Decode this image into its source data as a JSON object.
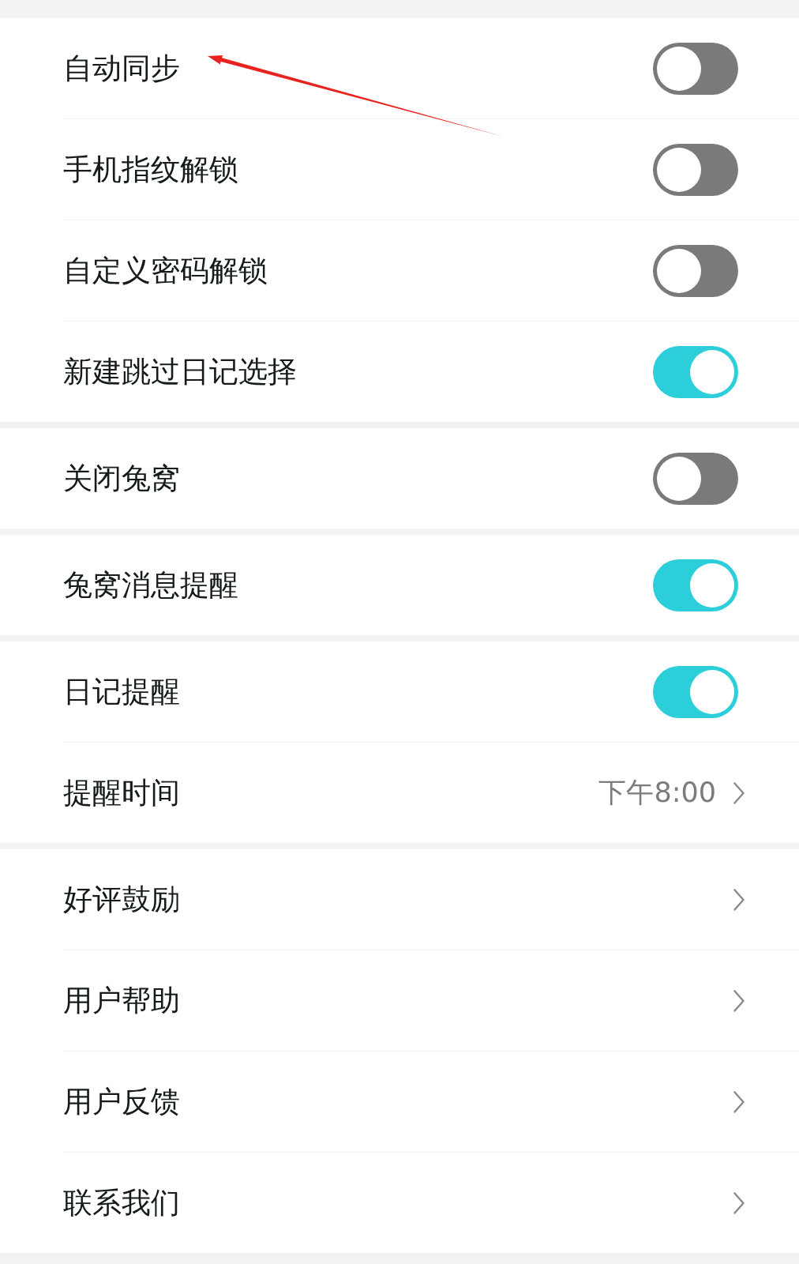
{
  "groups": [
    {
      "items": [
        {
          "kind": "toggle",
          "label": "自动同步",
          "on": false
        },
        {
          "kind": "toggle",
          "label": "手机指纹解锁",
          "on": false
        },
        {
          "kind": "toggle",
          "label": "自定义密码解锁",
          "on": false
        },
        {
          "kind": "toggle",
          "label": "新建跳过日记选择",
          "on": true
        }
      ]
    },
    {
      "items": [
        {
          "kind": "toggle",
          "label": "关闭兔窝",
          "on": false
        }
      ]
    },
    {
      "items": [
        {
          "kind": "toggle",
          "label": "兔窝消息提醒",
          "on": true
        }
      ]
    },
    {
      "items": [
        {
          "kind": "toggle",
          "label": "日记提醒",
          "on": true
        },
        {
          "kind": "link",
          "label": "提醒时间",
          "value": "下午8:00"
        }
      ]
    },
    {
      "items": [
        {
          "kind": "link",
          "label": "好评鼓励"
        },
        {
          "kind": "link",
          "label": "用户帮助"
        },
        {
          "kind": "link",
          "label": "用户反馈"
        },
        {
          "kind": "link",
          "label": "联系我们"
        }
      ]
    }
  ]
}
